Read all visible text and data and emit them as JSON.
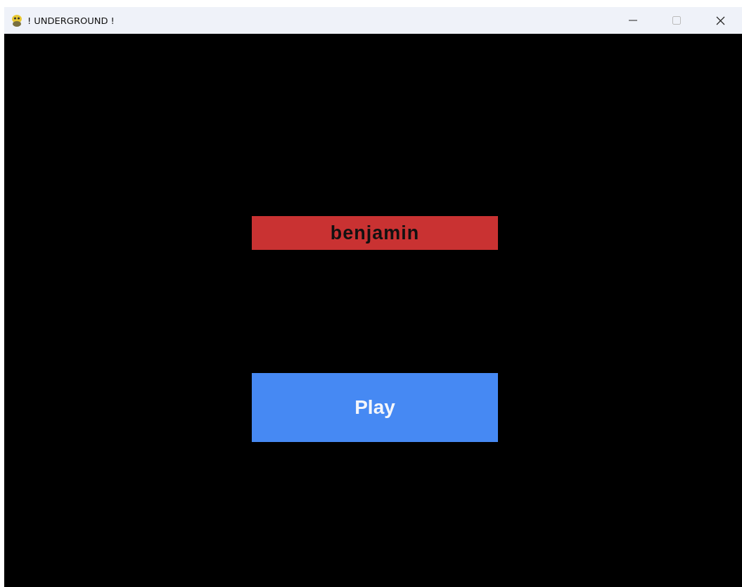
{
  "window": {
    "title": "! UNDERGROUND !"
  },
  "name_field": {
    "value": "benjamin"
  },
  "play_button": {
    "label": "Play"
  }
}
